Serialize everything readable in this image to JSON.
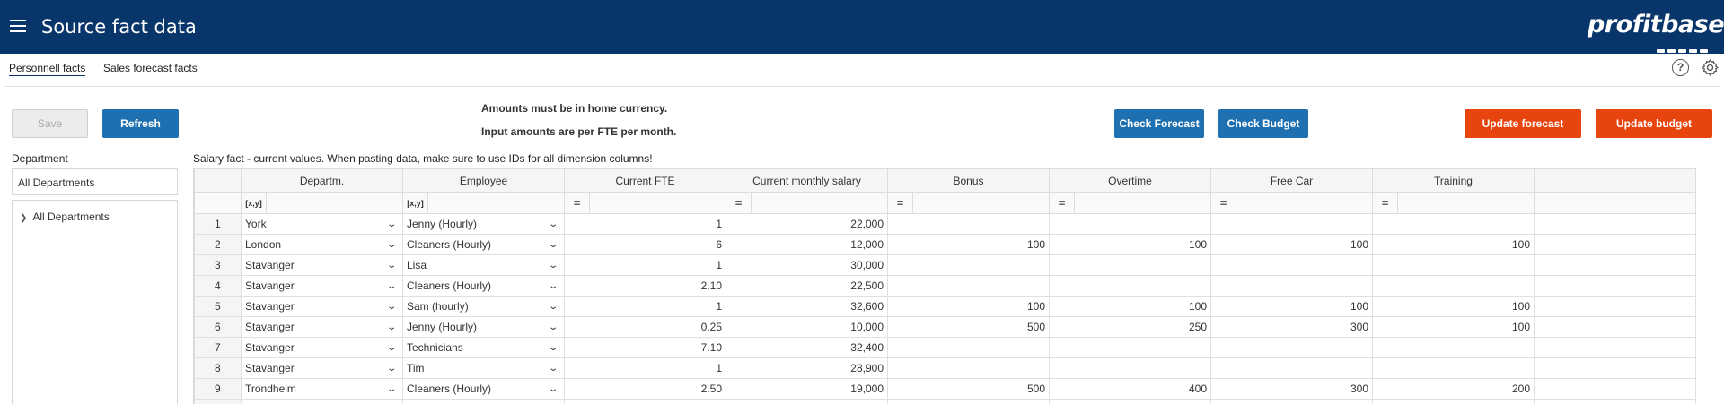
{
  "header": {
    "title": "Source fact data",
    "logo_text": "profitbase"
  },
  "tabs": [
    {
      "label": "Personnell facts",
      "active": true
    },
    {
      "label": "Sales forecast facts",
      "active": false
    }
  ],
  "toolbar": {
    "save_label": "Save",
    "refresh_label": "Refresh",
    "check_forecast_label": "Check Forecast",
    "check_budget_label": "Check Budget",
    "update_forecast_label": "Update forecast",
    "update_budget_label": "Update budget"
  },
  "notices": [
    "Amounts must be in home currency.",
    "Input amounts are per FTE per month."
  ],
  "department_panel": {
    "label": "Department",
    "selected": "All Departments",
    "tree": [
      {
        "label": "All Departments"
      }
    ]
  },
  "grid": {
    "caption": "Salary fact - current values. When pasting data, make sure to use IDs for all dimension columns!",
    "columns": [
      "Departm.",
      "Employee",
      "Current FTE",
      "Current monthly salary",
      "Bonus",
      "Overtime",
      "Free Car",
      "Training"
    ],
    "dim_filter_label": "[x,y]",
    "num_filter_label": "=",
    "rows": [
      [
        "1",
        "York",
        "Jenny (Hourly)",
        "1",
        "22,000",
        "",
        "",
        "",
        ""
      ],
      [
        "2",
        "London",
        "Cleaners (Hourly)",
        "6",
        "12,000",
        "100",
        "100",
        "100",
        "100"
      ],
      [
        "3",
        "Stavanger",
        "Lisa",
        "1",
        "30,000",
        "",
        "",
        "",
        ""
      ],
      [
        "4",
        "Stavanger",
        "Cleaners (Hourly)",
        "2.10",
        "22,500",
        "",
        "",
        "",
        ""
      ],
      [
        "5",
        "Stavanger",
        "Sam (hourly)",
        "1",
        "32,600",
        "100",
        "100",
        "100",
        "100"
      ],
      [
        "6",
        "Stavanger",
        "Jenny (Hourly)",
        "0.25",
        "10,000",
        "500",
        "250",
        "300",
        "100"
      ],
      [
        "7",
        "Stavanger",
        "Technicians",
        "7.10",
        "32,400",
        "",
        "",
        "",
        ""
      ],
      [
        "8",
        "Stavanger",
        "Tim",
        "1",
        "28,900",
        "",
        "",
        "",
        ""
      ],
      [
        "9",
        "Trondheim",
        "Cleaners (Hourly)",
        "2.50",
        "19,000",
        "500",
        "400",
        "300",
        "200"
      ]
    ]
  },
  "colors": {
    "header_bg": "#08366a",
    "primary_button": "#1e70b0",
    "accent_button": "#e8450e"
  }
}
